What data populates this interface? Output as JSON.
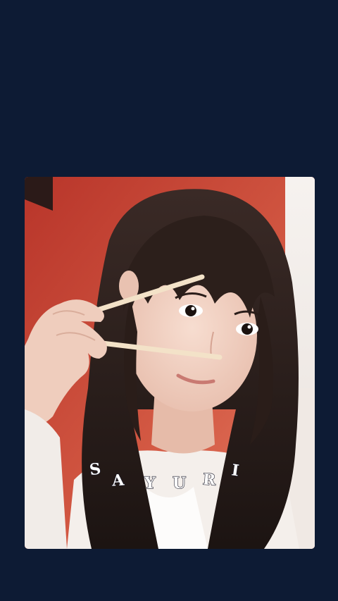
{
  "wallpaper": {
    "background_color": "#0d1b34",
    "photo": {
      "description_icon": "portrait-photo",
      "accent_color": "#c64a3a"
    },
    "name_label": "SAYURI",
    "name_letters": [
      "S",
      "A",
      "Y",
      "U",
      "R",
      "I"
    ]
  }
}
